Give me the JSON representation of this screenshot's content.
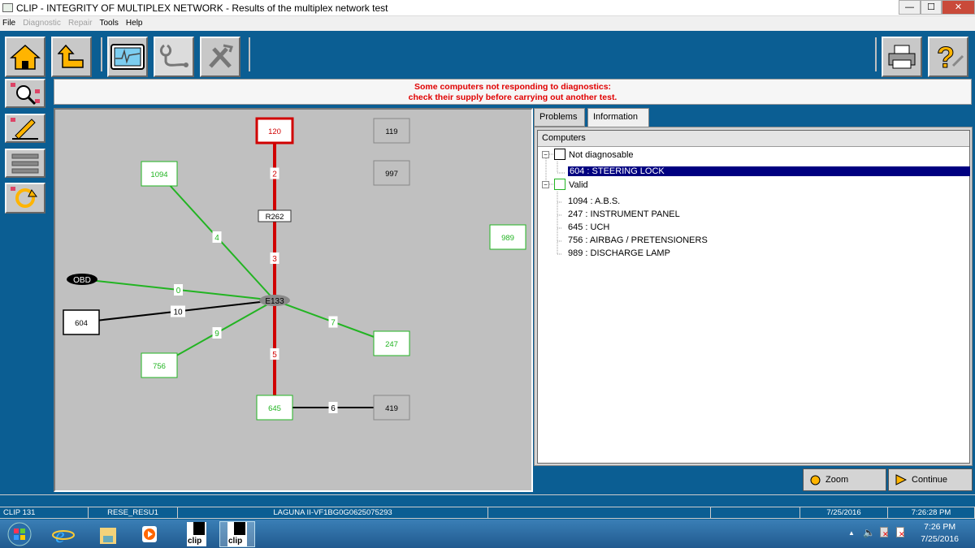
{
  "window": {
    "title": "CLIP - INTEGRITY OF MULTIPLEX NETWORK - Results of the multiplex network test",
    "minimize": "—",
    "maximize": "☐",
    "close": "✕"
  },
  "menu": [
    {
      "label": "File",
      "enabled": true
    },
    {
      "label": "Diagnostic",
      "enabled": false
    },
    {
      "label": "Repair",
      "enabled": false
    },
    {
      "label": "Tools",
      "enabled": true
    },
    {
      "label": "Help",
      "enabled": true
    }
  ],
  "message": {
    "line1": "Some computers not responding to diagnostics:",
    "line2": "check their supply before carrying out another test."
  },
  "colors": {
    "ok": "#22b422",
    "fault": "#d00000",
    "unknown": "#000000",
    "panel_bg": "#c0c0c0",
    "app_bg": "#0b5e93"
  },
  "diagram": {
    "nodes": [
      {
        "id": "120",
        "label": "120",
        "status": "fault"
      },
      {
        "id": "119",
        "label": "119",
        "status": "absent"
      },
      {
        "id": "997",
        "label": "997",
        "status": "absent"
      },
      {
        "id": "1094",
        "label": "1094",
        "status": "ok"
      },
      {
        "id": "R262",
        "label": "R262",
        "status": "junction"
      },
      {
        "id": "989",
        "label": "989",
        "status": "ok"
      },
      {
        "id": "OBD",
        "label": "OBD",
        "status": "obd"
      },
      {
        "id": "E133",
        "label": "E133",
        "status": "hub"
      },
      {
        "id": "604",
        "label": "604",
        "status": "unknown"
      },
      {
        "id": "247",
        "label": "247",
        "status": "ok"
      },
      {
        "id": "756",
        "label": "756",
        "status": "ok"
      },
      {
        "id": "645",
        "label": "645",
        "status": "ok"
      },
      {
        "id": "419",
        "label": "419",
        "status": "absent"
      }
    ],
    "links": [
      {
        "from": "120",
        "to": "R262",
        "label": "2",
        "status": "fault"
      },
      {
        "from": "R262",
        "to": "E133",
        "label": "3",
        "status": "fault"
      },
      {
        "from": "E133",
        "to": "645",
        "label": "5",
        "status": "fault"
      },
      {
        "from": "1094",
        "to": "E133",
        "label": "4",
        "status": "ok"
      },
      {
        "from": "OBD",
        "to": "E133",
        "label": "0",
        "status": "ok"
      },
      {
        "from": "604",
        "to": "E133",
        "label": "10",
        "status": "unknown"
      },
      {
        "from": "756",
        "to": "E133",
        "label": "9",
        "status": "ok"
      },
      {
        "from": "E133",
        "to": "247",
        "label": "7",
        "status": "ok"
      },
      {
        "from": "645",
        "to": "419",
        "label": "6",
        "status": "unknown"
      }
    ]
  },
  "tabs": [
    {
      "label": "Problems",
      "active": false
    },
    {
      "label": "Information",
      "active": true
    }
  ],
  "tree": {
    "header": "Computers",
    "groups": [
      {
        "label": "Not diagnosable",
        "color": "#000000",
        "items": [
          "604 : STEERING LOCK"
        ]
      },
      {
        "label": "Valid",
        "color": "#22b422",
        "items": [
          "1094 : A.B.S.",
          "247 : INSTRUMENT PANEL",
          "645 : UCH",
          "756 : AIRBAG / PRETENSIONERS",
          "989 : DISCHARGE LAMP"
        ]
      }
    ],
    "selected": "604 : STEERING LOCK"
  },
  "buttons": {
    "zoom": "Zoom",
    "continue": "Continue"
  },
  "status": {
    "cells": [
      "CLIP 131",
      "RESE_RESU1",
      "LAGUNA II-VF1BG0G0625075293",
      "",
      "",
      "7/25/2016",
      "7:26:28 PM"
    ]
  },
  "taskbar": {
    "time": "7:26 PM",
    "date": "7/25/2016"
  }
}
